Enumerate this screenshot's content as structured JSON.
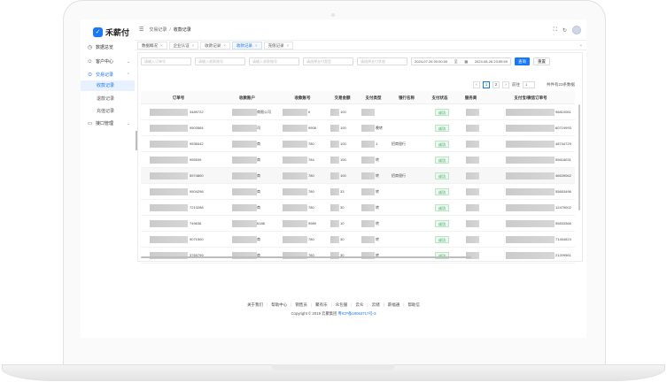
{
  "app": {
    "logo_mark": "✓",
    "name": "禾薪付"
  },
  "sidebar": {
    "items": [
      {
        "label": "数据总览",
        "icon": "◷"
      },
      {
        "label": "客户中心",
        "icon": "☺",
        "chevron": "⌄"
      },
      {
        "label": "交易记录",
        "icon": "⊙",
        "chevron": "⌃"
      },
      {
        "label": "接口管理",
        "icon": "▭",
        "chevron": "⌄"
      }
    ],
    "sub_items": [
      "收款记录",
      "退款记录",
      "充值记录"
    ]
  },
  "header": {
    "fold_icon": "☰",
    "breadcrumb": [
      "交易记录",
      "收款记录"
    ],
    "crumb_sep": "/",
    "fullscreen_icon": "⛶",
    "refresh_icon": "↻"
  },
  "tags": [
    {
      "label": "数据概况"
    },
    {
      "label": "企业认证"
    },
    {
      "label": "收款记录"
    },
    {
      "label": "收款记录"
    },
    {
      "label": "充值记录"
    }
  ],
  "tag_close": "×",
  "tag_more": "⌄",
  "filters": {
    "placeholders": [
      "请输入订单号",
      "请输入收款账号",
      "请输入收款账号",
      "请选择支付类型",
      "请选择支付状态"
    ],
    "date_start": "2024-07-26 00:00:00",
    "date_sep": "至",
    "date_end": "2024-08-26 23:59:59",
    "calendar_icon": "▦",
    "query": "查询",
    "reset": "重置"
  },
  "pager": {
    "prev": "‹",
    "pages": [
      "1",
      "2"
    ],
    "next": "›",
    "goto_label": "前往",
    "goto_value": "1",
    "total": "共件有23条数据"
  },
  "table": {
    "headers": [
      "订单号",
      "收款账户",
      "收款账号",
      "交易金额",
      "支付类型",
      "银行名称",
      "支付状态",
      "服务商",
      "支付宝/微信订单号"
    ],
    "rows": [
      {
        "order": "3489722",
        "acct": "商限公司",
        "no": "ri",
        "amount": "100",
        "type": "",
        "bank": "",
        "status": "成功",
        "ext": "98810061"
      },
      {
        "order": "9503564",
        "acct": "司",
        "no": "9908",
        "amount": "100",
        "type": "晚转",
        "bank": "",
        "status": "成功",
        "ext": "60719993"
      },
      {
        "order": "9536042",
        "acct": "商",
        "no": "780",
        "amount": "100",
        "type": "1",
        "bank": "招商银行",
        "status": "成功",
        "ext": "48744729"
      },
      {
        "order": "955539",
        "acct": "商",
        "no": "784",
        "amount": "100",
        "type": "转",
        "bank": "",
        "status": "成功",
        "ext": "55618031"
      },
      {
        "order": "5974800",
        "acct": "商",
        "no": "780",
        "amount": "100",
        "type": "转",
        "bank": "招商银行",
        "status": "成功",
        "ext": "46639062"
      },
      {
        "order": "9504298",
        "acct": "商",
        "no": "780",
        "amount": "33",
        "type": "转",
        "bank": "",
        "status": "成功",
        "ext": "55653496"
      },
      {
        "order": "7213288",
        "acct": "商",
        "no": "780",
        "amount": "30",
        "type": "转",
        "bank": "",
        "status": "成功",
        "ext": "12479002"
      },
      {
        "order": "749636",
        "acct": "6188",
        "no": "9989",
        "amount": "10",
        "type": "转",
        "bank": "",
        "status": "成功",
        "ext": "55833366"
      },
      {
        "order": "9071500",
        "acct": "商",
        "no": "780",
        "amount": "30",
        "type": "转",
        "bank": "",
        "status": "成功",
        "ext": "71454524"
      },
      {
        "order": "3769799",
        "acct": "商",
        "no": "780",
        "amount": "30",
        "type": "转",
        "bank": "",
        "status": "成功",
        "ext": "21209561"
      }
    ]
  },
  "footer": {
    "links": [
      "关于我们",
      "帮助中心",
      "销售员",
      "聚有乐",
      "众包服",
      "云众",
      "云储",
      "薪福通",
      "帮助信"
    ],
    "copyright": "Copyright © 2019 云聚集团",
    "icp": "粤ICP备19063717号-3"
  }
}
